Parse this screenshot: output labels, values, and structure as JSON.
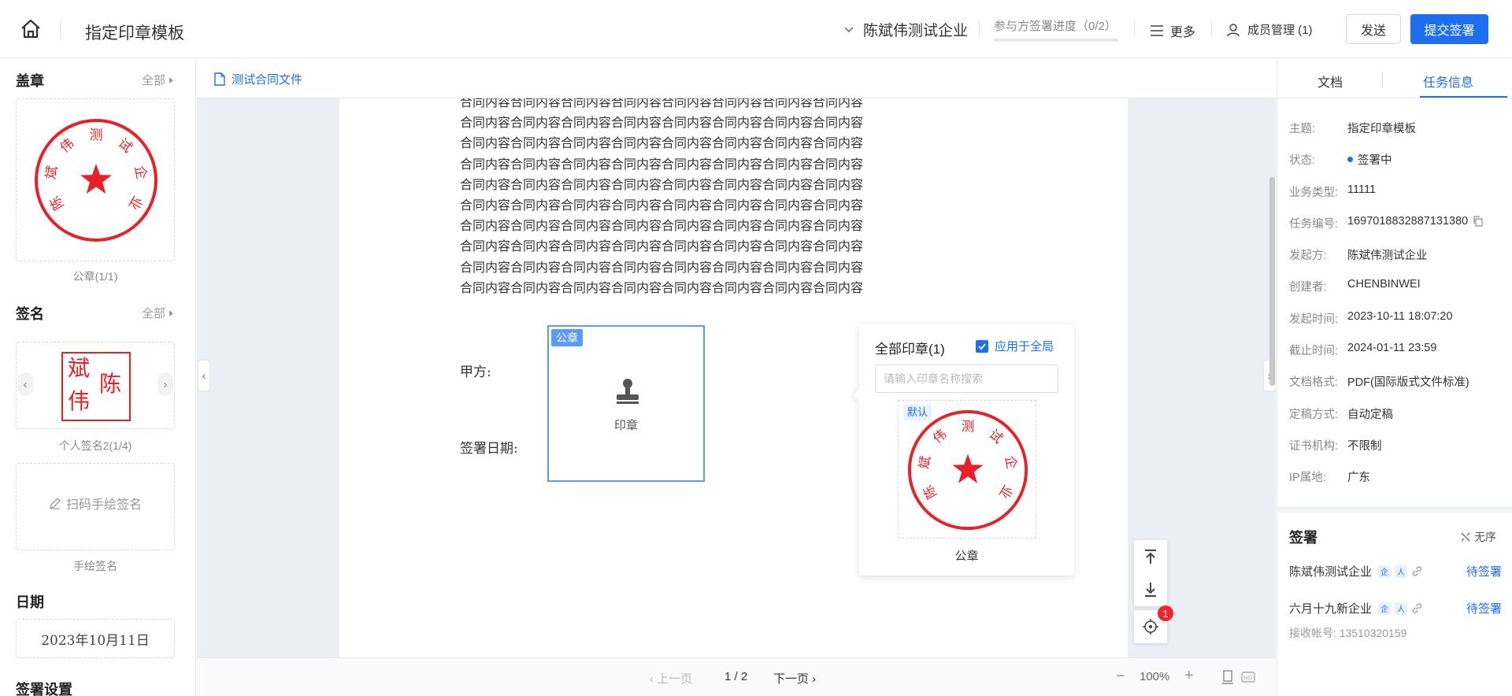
{
  "header": {
    "title": "指定印章模板",
    "company": "陈斌伟测试企业",
    "progress_label": "参与方签署进度（0/2）",
    "progress_value": 0,
    "more_label": "更多",
    "members_label": "成员管理 (1)",
    "send_label": "发送",
    "submit_label": "提交签署"
  },
  "left": {
    "seal_section": {
      "title": "盖章",
      "all_label": "全部",
      "caption": "公章(1/1)",
      "seal_text": "陈斌伟测试企业"
    },
    "signature_section": {
      "title": "签名",
      "all_label": "全部",
      "caption": "个人签名2(1/4)",
      "sign_chars": [
        "斌",
        "陈",
        "伟"
      ]
    },
    "handwrite": {
      "label": "扫码手绘签名",
      "caption": "手绘签名"
    },
    "date_section": {
      "title": "日期",
      "value": "2023年10月11日"
    },
    "settings_title": "签署设置"
  },
  "document": {
    "tab_label": "测试合同文件",
    "body_line": "合同内容合同内容合同内容合同内容合同内容合同内容合同内容合同内容",
    "body_line_count": 10,
    "party_label": "甲方:",
    "sign_date_label": "签署日期:",
    "seal_slot": {
      "tag": "公章",
      "label": "印章"
    },
    "seal_popover": {
      "title": "全部印章(1)",
      "apply_all_label": "应用于全局",
      "apply_all_checked": true,
      "search_placeholder": "请输入印章名称搜索",
      "default_tag": "默认",
      "seal_name": "公章"
    },
    "locate_badge": "1",
    "pager": {
      "prev": "上一页",
      "page": "1 / 2",
      "next": "下一页",
      "zoom": "100%"
    }
  },
  "right": {
    "tabs": [
      "文档",
      "任务信息"
    ],
    "active_tab": "任务信息",
    "info": [
      {
        "key": "主题:",
        "value": "指定印章模板"
      },
      {
        "key": "状态:",
        "value": "签署中"
      },
      {
        "key": "业务类型:",
        "value": "11111"
      },
      {
        "key": "任务编号:",
        "value": "1697018832887131380"
      },
      {
        "key": "发起方:",
        "value": "陈斌伟测试企业"
      },
      {
        "key": "创建者:",
        "value": "CHENBINWEI"
      },
      {
        "key": "发起时间:",
        "value": "2023-10-11 18:07:20"
      },
      {
        "key": "截止时间:",
        "value": "2024-01-11 23:59"
      },
      {
        "key": "文档格式:",
        "value": "PDF(国际版式文件标准)"
      },
      {
        "key": "定稿方式:",
        "value": "自动定稿"
      },
      {
        "key": "证书机构:",
        "value": "不限制"
      },
      {
        "key": "IP属地:",
        "value": "广东"
      }
    ],
    "sign": {
      "title": "签署",
      "order": "无序",
      "signers": [
        {
          "name": "陈斌伟测试企业",
          "status": "待签署"
        },
        {
          "name": "六月十九新企业",
          "status": "待签署"
        }
      ],
      "receiver_label": "接收帐号:",
      "receiver_value": "13510320159"
    }
  },
  "colors": {
    "accent": "#1e6ef0",
    "seal_red": "#e8202a"
  }
}
